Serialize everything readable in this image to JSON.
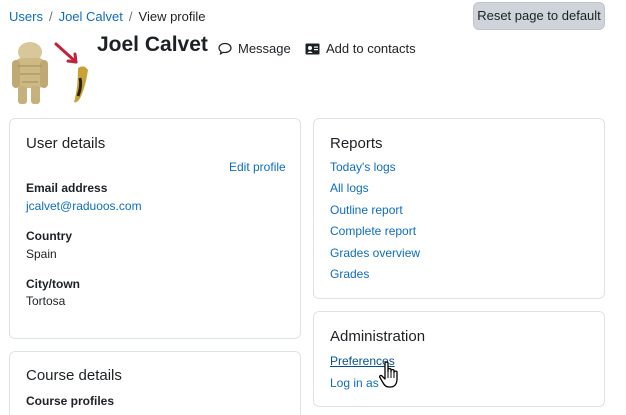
{
  "breadcrumb": {
    "items": [
      "Users",
      "Joel Calvet",
      "View profile"
    ],
    "separator": "/"
  },
  "reset_button": "Reset page to default",
  "profile": {
    "name": "Joel Calvet",
    "message_label": "Message",
    "add_contacts_label": "Add to contacts"
  },
  "user_details": {
    "title": "User details",
    "edit_link": "Edit profile",
    "email_label": "Email address",
    "email_value": "jcalvet@raduoos.com",
    "country_label": "Country",
    "country_value": "Spain",
    "city_label": "City/town",
    "city_value": "Tortosa"
  },
  "reports": {
    "title": "Reports",
    "links": [
      "Today's logs",
      "All logs",
      "Outline report",
      "Complete report",
      "Grades overview",
      "Grades"
    ]
  },
  "administration": {
    "title": "Administration",
    "links": [
      "Preferences",
      "Log in as"
    ]
  },
  "course_details": {
    "title": "Course details",
    "profiles_label": "Course profiles"
  },
  "colors": {
    "link": "#0f6cbf",
    "text": "#1d2125",
    "button_bg": "#ced4da",
    "card_border": "#dee2e6",
    "arrow": "#c0243a"
  },
  "icons": [
    "message-icon",
    "address-card-icon",
    "hand-pointer-cursor-icon"
  ]
}
